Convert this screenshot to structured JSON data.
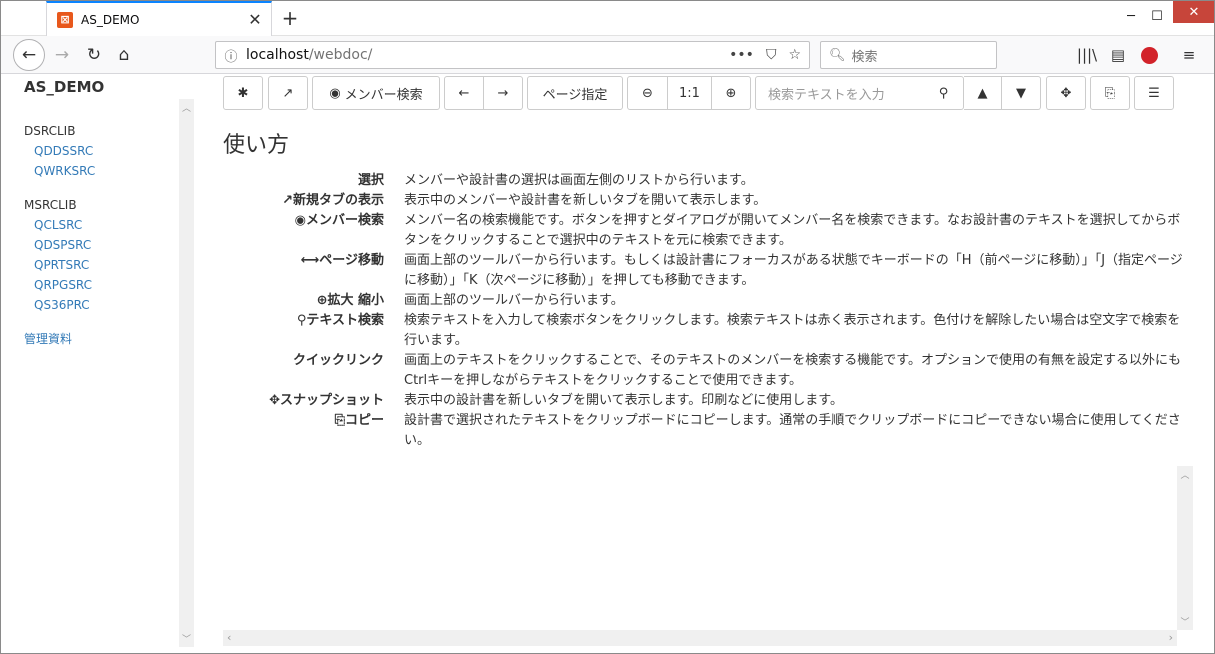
{
  "browser": {
    "tab_title": "AS_DEMO",
    "url_host": "localhost",
    "url_path": "/webdoc/",
    "search_placeholder": "検索",
    "colors": {
      "accent": "#0a84ff",
      "close": "#c7453a"
    }
  },
  "sidebar": {
    "title": "AS_DEMO",
    "groups": [
      {
        "name": "DSRCLIB",
        "items": [
          "QDDSSRC",
          "QWRKSRC"
        ]
      },
      {
        "name": "MSRCLIB",
        "items": [
          "QCLSRC",
          "QDSPSRC",
          "QPRTSRC",
          "QRPGSRC",
          "QS36PRC"
        ]
      }
    ],
    "extra_link": "管理資料"
  },
  "toolbar": {
    "member_search_label": "メンバー検索",
    "page_select_label": "ページ指定",
    "zoom_reset_label": "1:1",
    "search_placeholder": "検索テキストを入力"
  },
  "doc": {
    "title": "使い方",
    "rows": [
      {
        "icon": "",
        "term": "選択",
        "desc": "メンバーや設計書の選択は画面左側のリストから行います。"
      },
      {
        "icon": "external-link-icon",
        "term": "新規タブの表示",
        "desc": "表示中のメンバーや設計書を新しいタブを開いて表示します。"
      },
      {
        "icon": "eye-icon",
        "term": "メンバー検索",
        "desc": "メンバー名の検索機能です。ボタンを押すとダイアログが開いてメンバー名を検索できます。なお設計書のテキストを選択してからボタンをクリックすることで選択中のテキストを元に検索できます。"
      },
      {
        "icon": "left-right-arrow-icon",
        "term": "ページ移動",
        "desc": "画面上部のツールバーから行います。もしくは設計書にフォーカスがある状態でキーボードの「H（前ページに移動）」「J（指定ページに移動）」「K（次ページに移動）」を押しても移動できます。"
      },
      {
        "icon": "zoom-icon",
        "term": "拡大 縮小",
        "desc": "画面上部のツールバーから行います。"
      },
      {
        "icon": "search-icon",
        "term": "テキスト検索",
        "desc": "検索テキストを入力して検索ボタンをクリックします。検索テキストは赤く表示されます。色付けを解除したい場合は空文字で検索を行います。"
      },
      {
        "icon": "",
        "term": "クイックリンク",
        "desc": "画面上のテキストをクリックすることで、そのテキストのメンバーを検索する機能です。オプションで使用の有無を設定する以外にもCtrlキーを押しながらテキストをクリックすることで使用できます。"
      },
      {
        "icon": "crosshair-icon",
        "term": "スナップショット",
        "desc": "表示中の設計書を新しいタブを開いて表示します。印刷などに使用します。"
      },
      {
        "icon": "copy-icon",
        "term": "コピー",
        "desc": "設計書で選択されたテキストをクリップボードにコピーします。通常の手順でクリップボードにコピーできない場合に使用してください。"
      }
    ]
  }
}
